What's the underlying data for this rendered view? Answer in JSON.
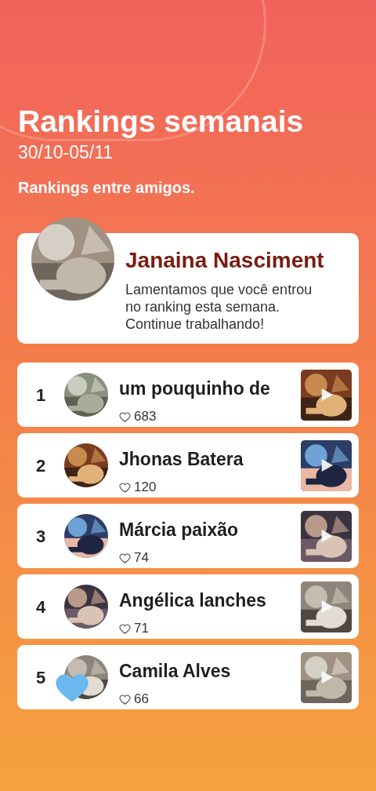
{
  "header": {
    "title": "Rankings semanais",
    "date_range": "30/10-05/11",
    "subtitle": "Rankings entre amigos."
  },
  "me": {
    "name": "Janaina Nasciment",
    "message": "Lamentamos que você entrou no ranking esta semana. Continue trabalhando!"
  },
  "rankings": [
    {
      "rank": "1",
      "name": "um pouquinho de",
      "likes": "683",
      "sticker": false
    },
    {
      "rank": "2",
      "name": "Jhonas Batera",
      "likes": "120",
      "sticker": false
    },
    {
      "rank": "3",
      "name": "Márcia paixão",
      "likes": "74",
      "sticker": false
    },
    {
      "rank": "4",
      "name": "Angélica lanches",
      "likes": "71",
      "sticker": false
    },
    {
      "rank": "5",
      "name": "Camila Alves",
      "likes": "66",
      "sticker": true
    }
  ]
}
